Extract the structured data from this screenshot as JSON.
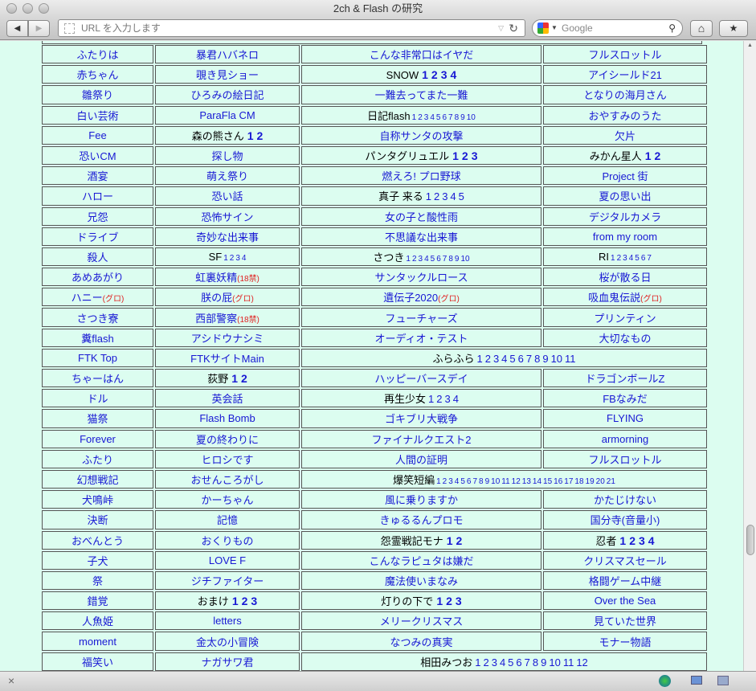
{
  "window": {
    "title": "2ch & Flash の研究"
  },
  "toolbar": {
    "back": "◀",
    "forward": "▶",
    "url_placeholder": "URL を入力します",
    "search_placeholder": "Google",
    "reload": "↻",
    "home": "⌂",
    "bookmark": "★"
  },
  "status": {
    "close": "×"
  },
  "rows": [
    [
      {
        "t": "ふたりは"
      },
      {
        "t": "暴君ハバネロ"
      },
      {
        "t": "こんな非常口はイヤだ"
      },
      {
        "t": "フルスロットル"
      }
    ],
    [
      {
        "t": "赤ちゃん"
      },
      {
        "t": "覗き見ショー"
      },
      {
        "t": "SNOW",
        "p": 1,
        "ns": "b",
        "n": [
          "1",
          "2",
          "3",
          "4"
        ]
      },
      {
        "t": "アイシールド21"
      }
    ],
    [
      {
        "t": "雛祭り"
      },
      {
        "t": "ひろみの絵日記"
      },
      {
        "t": "一難去ってまた一難"
      },
      {
        "t": "となりの海月さん"
      }
    ],
    [
      {
        "t": "白い芸術"
      },
      {
        "t": "ParaFla CM"
      },
      {
        "t": "日記flash",
        "p": 1,
        "ns": "s",
        "n": [
          "1",
          "2",
          "3",
          "4",
          "5",
          "6",
          "7",
          "8",
          "9",
          "10"
        ]
      },
      {
        "t": "おやすみのうた"
      }
    ],
    [
      {
        "t": "Fee"
      },
      {
        "t": "森の熊さん",
        "p": 1,
        "ns": "b",
        "n": [
          "1",
          "2"
        ]
      },
      {
        "t": "自称サンタの攻撃"
      },
      {
        "t": "欠片"
      }
    ],
    [
      {
        "t": "恐いCM"
      },
      {
        "t": "探し物"
      },
      {
        "t": "パンタグリュエル",
        "p": 1,
        "ns": "b",
        "n": [
          "1",
          "2",
          "3"
        ]
      },
      {
        "t": "みかん星人",
        "p": 1,
        "ns": "b",
        "n": [
          "1",
          "2"
        ]
      }
    ],
    [
      {
        "t": "酒宴"
      },
      {
        "t": "萌え祭り"
      },
      {
        "t": "燃えろ! プロ野球"
      },
      {
        "t": "Project 街"
      }
    ],
    [
      {
        "t": "ハロー"
      },
      {
        "t": "恐い話"
      },
      {
        "t": "真子 来る",
        "p": 1,
        "ns": "m",
        "n": [
          "1",
          "2",
          "3",
          "4",
          "5"
        ]
      },
      {
        "t": "夏の思い出"
      }
    ],
    [
      {
        "t": "兄怨"
      },
      {
        "t": "恐怖サイン"
      },
      {
        "t": "女の子と酸性雨"
      },
      {
        "t": "デジタルカメラ"
      }
    ],
    [
      {
        "t": "ドライブ"
      },
      {
        "t": "奇妙な出来事"
      },
      {
        "t": "不思議な出来事"
      },
      {
        "t": "from my room"
      }
    ],
    [
      {
        "t": "殺人"
      },
      {
        "t": "SF",
        "p": 1,
        "ns": "s",
        "n": [
          "1",
          "2",
          "3",
          "4"
        ]
      },
      {
        "t": "さつき",
        "p": 1,
        "ns": "s",
        "n": [
          "1",
          "2",
          "3",
          "4",
          "5",
          "6",
          "7",
          "8",
          "9",
          "10"
        ]
      },
      {
        "t": "RI",
        "p": 1,
        "ns": "s",
        "n": [
          "1",
          "2",
          "3",
          "4",
          "5",
          "6",
          "7"
        ]
      }
    ],
    [
      {
        "t": "あめあがり"
      },
      {
        "t": "虹裏妖精",
        "g": "(18禁)"
      },
      {
        "t": "サンタックルロース"
      },
      {
        "t": "桜が散る日"
      }
    ],
    [
      {
        "t": "ハニー",
        "g": "(グロ)"
      },
      {
        "t": "朕の屁",
        "g": "(グロ)"
      },
      {
        "t": "遺伝子2020",
        "g": "(グロ)"
      },
      {
        "t": "吸血鬼伝説",
        "g": "(グロ)"
      }
    ],
    [
      {
        "t": "さつき寮"
      },
      {
        "t": "西部警察",
        "g": "(18禁)"
      },
      {
        "t": "フューチャーズ"
      },
      {
        "t": "プリンティン"
      }
    ],
    [
      {
        "t": "糞flash"
      },
      {
        "t": "アシドウナシミ"
      },
      {
        "t": "オーディオ・テスト"
      },
      {
        "t": "大切なもの"
      }
    ],
    [
      {
        "t": "FTK Top"
      },
      {
        "t": "FTKサイトMain"
      },
      {
        "t": "ふらふら",
        "p": 1,
        "ns": "m",
        "span": 2,
        "n": [
          "1",
          "2",
          "3",
          "4",
          "5",
          "6",
          "7",
          "8",
          "9",
          "10",
          "11"
        ]
      }
    ],
    [
      {
        "t": "ちゃーはん"
      },
      {
        "t": "荻野",
        "p": 1,
        "ns": "b",
        "n": [
          "1",
          "2"
        ]
      },
      {
        "t": "ハッピーバースデイ"
      },
      {
        "t": "ドラゴンボールZ"
      }
    ],
    [
      {
        "t": "ドル"
      },
      {
        "t": "英会話"
      },
      {
        "t": "再生少女",
        "p": 1,
        "ns": "m",
        "n": [
          "1",
          "2",
          "3",
          "4"
        ]
      },
      {
        "t": "FBなみだ"
      }
    ],
    [
      {
        "t": "猫祭"
      },
      {
        "t": "Flash Bomb"
      },
      {
        "t": "ゴキブリ大戦争"
      },
      {
        "t": "FLYING"
      }
    ],
    [
      {
        "t": "Forever"
      },
      {
        "t": "夏の終わりに"
      },
      {
        "t": "ファイナルクエスト2"
      },
      {
        "t": "armorning"
      }
    ],
    [
      {
        "t": "ふたり"
      },
      {
        "t": "ヒロシです"
      },
      {
        "t": "人間の証明"
      },
      {
        "t": "フルスロットル"
      }
    ],
    [
      {
        "t": "幻想戦記"
      },
      {
        "t": "おせんころがし"
      },
      {
        "t": "爆笑短編",
        "p": 1,
        "ns": "s",
        "span": 2,
        "n": [
          "1",
          "2",
          "3",
          "4",
          "5",
          "6",
          "7",
          "8",
          "9",
          "10",
          "11",
          "12",
          "13",
          "14",
          "15",
          "16",
          "17",
          "18",
          "19",
          "20",
          "21"
        ]
      }
    ],
    [
      {
        "t": "犬鳴峠"
      },
      {
        "t": "かーちゃん"
      },
      {
        "t": "風に乗りますか"
      },
      {
        "t": "かたじけない"
      }
    ],
    [
      {
        "t": "決断"
      },
      {
        "t": "記憶"
      },
      {
        "t": "きゅるるんプロモ"
      },
      {
        "t": "国分寺(音量小)"
      }
    ],
    [
      {
        "t": "おべんとう"
      },
      {
        "t": "おくりもの"
      },
      {
        "t": "怨霊戦記モナ",
        "p": 1,
        "ns": "b",
        "n": [
          "1",
          "2"
        ]
      },
      {
        "t": "忍者",
        "p": 1,
        "ns": "b",
        "n": [
          "1",
          "2",
          "3",
          "4"
        ]
      }
    ],
    [
      {
        "t": "子犬"
      },
      {
        "t": "LOVE F"
      },
      {
        "t": "こんなラピュタは嫌だ"
      },
      {
        "t": "クリスマスセール"
      }
    ],
    [
      {
        "t": "祭"
      },
      {
        "t": "ジチファイター"
      },
      {
        "t": "魔法使いまなみ"
      },
      {
        "t": "格闘ゲーム中継"
      }
    ],
    [
      {
        "t": "錯覚"
      },
      {
        "t": "おまけ",
        "p": 1,
        "ns": "b",
        "n": [
          "1",
          "2",
          "3"
        ]
      },
      {
        "t": "灯りの下で",
        "p": 1,
        "ns": "b",
        "n": [
          "1",
          "2",
          "3"
        ]
      },
      {
        "t": "Over the Sea"
      }
    ],
    [
      {
        "t": "人魚姫"
      },
      {
        "t": "letters"
      },
      {
        "t": "メリークリスマス"
      },
      {
        "t": "見ていた世界"
      }
    ],
    [
      {
        "t": "moment"
      },
      {
        "t": "金太の小冒険"
      },
      {
        "t": "なつみの真実"
      },
      {
        "t": "モナー物語"
      }
    ],
    [
      {
        "t": "福笑い"
      },
      {
        "t": "ナガサワ君"
      },
      {
        "t": "相田みつお",
        "p": 1,
        "ns": "m",
        "span": 2,
        "n": [
          "1",
          "2",
          "3",
          "4",
          "5",
          "6",
          "7",
          "8",
          "9",
          "10",
          "11",
          "12"
        ]
      }
    ]
  ]
}
